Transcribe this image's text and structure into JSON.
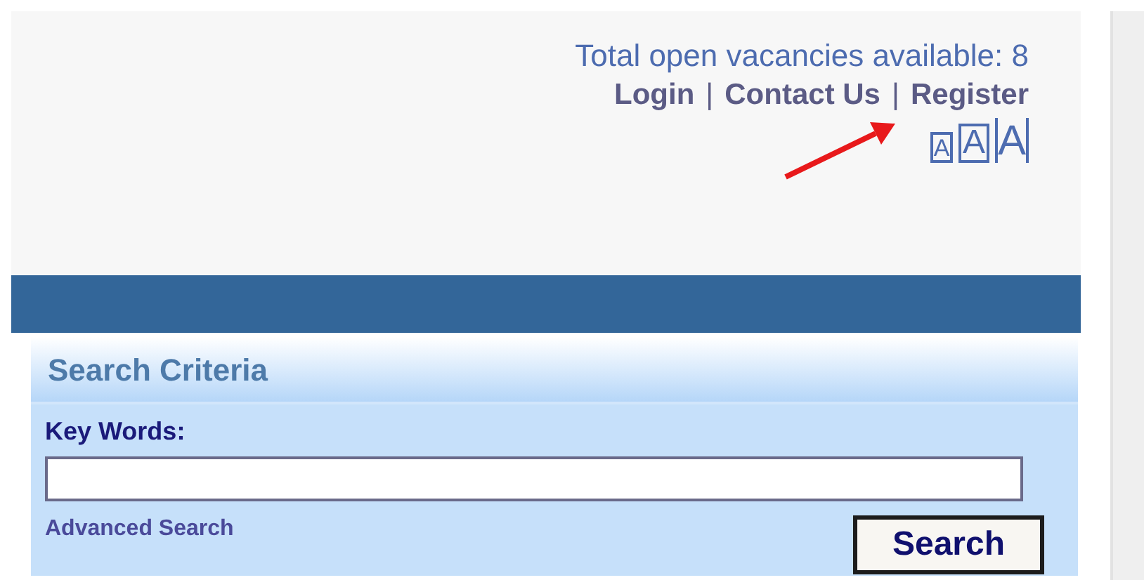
{
  "header": {
    "vacancies": "Total open vacancies available: 8",
    "links": [
      {
        "label": "Login"
      },
      {
        "label": "Contact Us"
      },
      {
        "label": "Register"
      }
    ],
    "separator": "|",
    "font_sizes": [
      {
        "label": "A",
        "kind": "small"
      },
      {
        "label": "A",
        "kind": "medium"
      },
      {
        "label": "A",
        "kind": "large"
      }
    ]
  },
  "search_panel": {
    "title": "Search Criteria",
    "field_label": "Key Words:",
    "advanced_link": "Advanced Search",
    "button": "Search"
  }
}
